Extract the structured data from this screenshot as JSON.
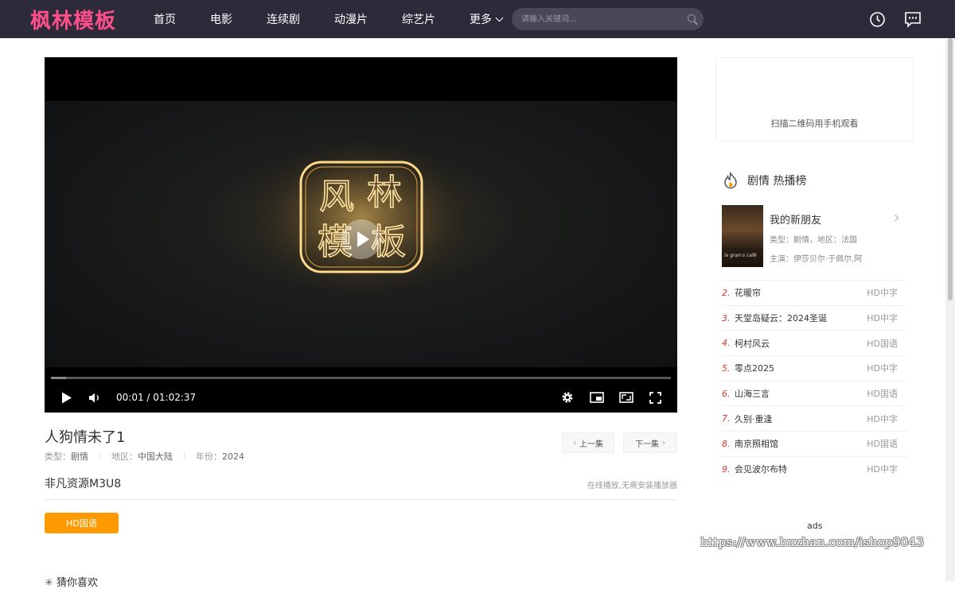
{
  "header": {
    "logo": "枫林模板",
    "nav": [
      {
        "label": "首页"
      },
      {
        "label": "电影"
      },
      {
        "label": "连续剧"
      },
      {
        "label": "动漫片"
      },
      {
        "label": "综艺片"
      },
      {
        "label": "更多"
      }
    ],
    "search_placeholder": "请输入关键词...",
    "icons": [
      "history-icon",
      "message-icon"
    ]
  },
  "player": {
    "current_time": "00:01",
    "duration": "01:02:37",
    "time_display": "00:01 / 01:02:37",
    "progress_fraction": 0.025,
    "watermark_logo_text": "枫林模板"
  },
  "video": {
    "title": "人狗情未了1",
    "meta": [
      {
        "key": "类型：",
        "value": "剧情"
      },
      {
        "key": "地区：",
        "value": "中国大陆"
      },
      {
        "key": "年份：",
        "value": "2024"
      }
    ],
    "prev_label": "上一集",
    "next_label": "下一集"
  },
  "source": {
    "title": "非凡资源M3U8",
    "note": "在线播放,无需安装播放器",
    "episode_button": "HD国语"
  },
  "bottom_heading": "猜你喜欢",
  "sidebar": {
    "qr_text": "扫描二维码用手机观看",
    "ranking_title": "剧情 热播榜",
    "top_item": {
      "name": "我的新朋友",
      "meta": "类型：剧情，地区：法国",
      "cast": "主演：伊莎贝尔·于佩尔,阿",
      "poster_text": "la gran·s café"
    },
    "items": [
      {
        "num": "2.",
        "title": "花暖帘",
        "tag": "HD中字"
      },
      {
        "num": "3.",
        "title": "天堂岛疑云：2024圣诞",
        "tag": "HD中字"
      },
      {
        "num": "4.",
        "title": "柯村风云",
        "tag": "HD国语"
      },
      {
        "num": "5.",
        "title": "零点2025",
        "tag": "HD中字"
      },
      {
        "num": "6.",
        "title": "山海三言",
        "tag": "HD国语"
      },
      {
        "num": "7.",
        "title": "久别·重逢",
        "tag": "HD中字"
      },
      {
        "num": "8.",
        "title": "南京照相馆",
        "tag": "HD国语"
      },
      {
        "num": "9.",
        "title": "会见波尔布特",
        "tag": "HD中字"
      }
    ],
    "ads_label": "ads"
  },
  "watermark": "https://www.huzhan.com/ishop9043",
  "colors": {
    "header_bg": "#2d2b3a",
    "logo": "#ff4f8b",
    "accent": "#ff9900",
    "rank_number": "#e0352b"
  }
}
